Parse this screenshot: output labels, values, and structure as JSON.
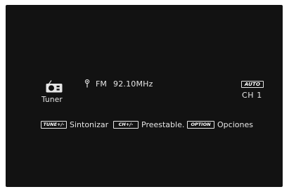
{
  "source": {
    "label": "Tuner",
    "icon": "radio-icon"
  },
  "station": {
    "signal_icon": "antenna-icon",
    "band": "FM",
    "frequency": "92.10MHz"
  },
  "tuning": {
    "mode": "AUTO",
    "channel": "CH 1"
  },
  "hints": [
    {
      "key": "TUNE+/-",
      "action": "Sintonizar"
    },
    {
      "key": "CH+/-",
      "action": "Preestable."
    },
    {
      "key": "OPTION",
      "action": "Opciones"
    }
  ],
  "colors": {
    "screen_background": "#121212",
    "text": "#e6e6e6",
    "page_background": "#ffffff"
  }
}
